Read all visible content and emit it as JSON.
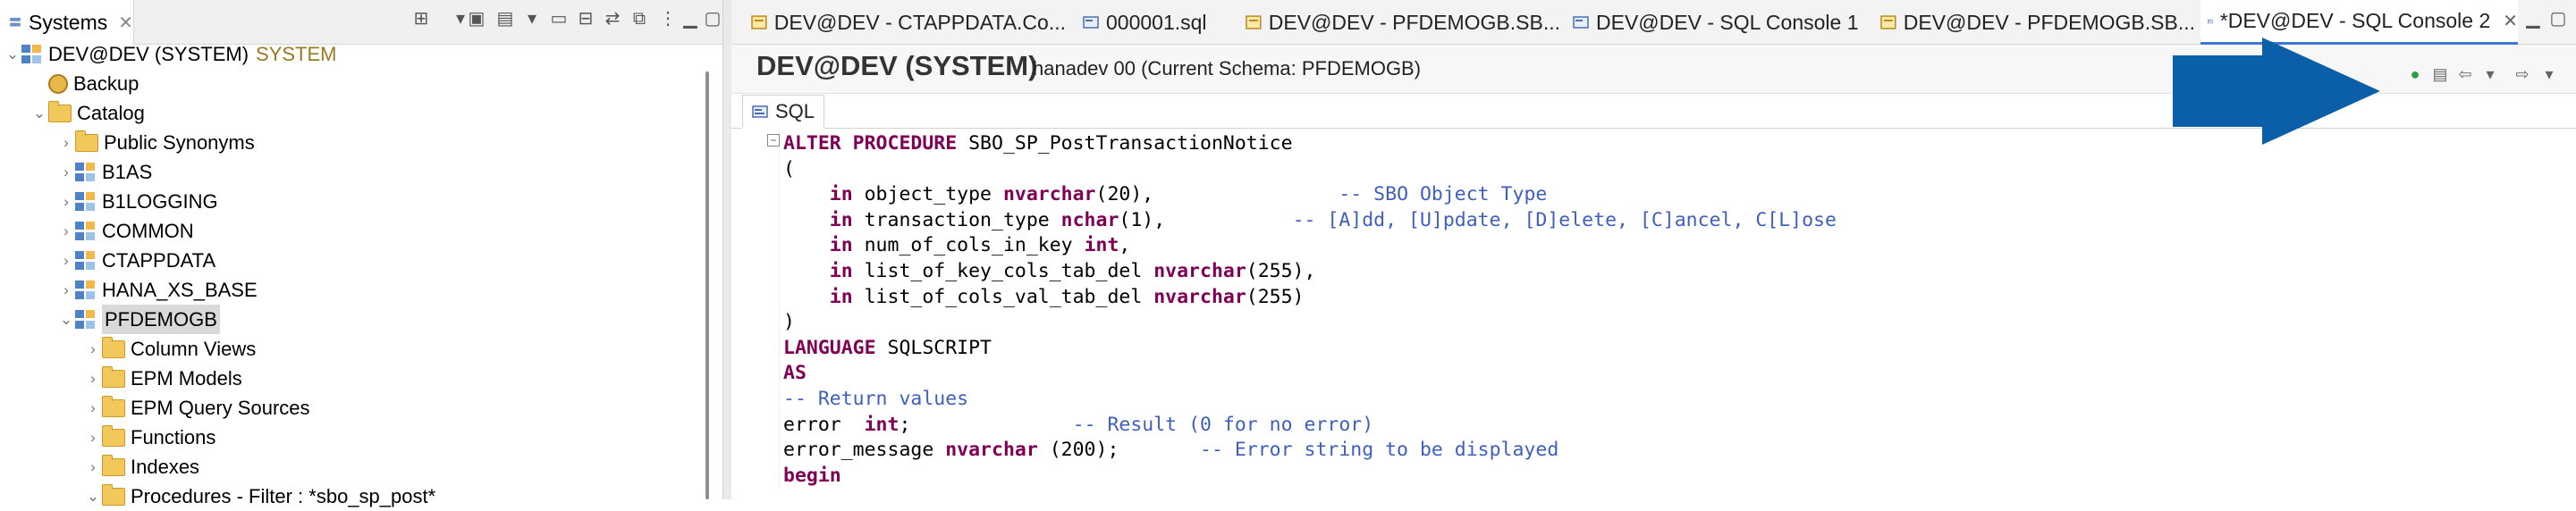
{
  "left_panel": {
    "tab_label": "Systems",
    "tree": [
      {
        "label": "DEV@DEV (SYSTEM)",
        "suffix": "SYSTEM",
        "level": 0,
        "expanded": true,
        "icon": "system-icon"
      },
      {
        "label": "Backup",
        "level": 1,
        "icon": "backup-icon"
      },
      {
        "label": "Catalog",
        "level": 1,
        "expanded": true,
        "icon": "folder-icon"
      },
      {
        "label": "Public Synonyms",
        "level": 2,
        "icon": "folder-icon"
      },
      {
        "label": "B1AS",
        "level": 2,
        "icon": "schema-icon"
      },
      {
        "label": "B1LOGGING",
        "level": 2,
        "icon": "schema-icon"
      },
      {
        "label": "COMMON",
        "level": 2,
        "icon": "schema-icon"
      },
      {
        "label": "CTAPPDATA",
        "level": 2,
        "icon": "schema-icon"
      },
      {
        "label": "HANA_XS_BASE",
        "level": 2,
        "icon": "schema-icon"
      },
      {
        "label": "PFDEMOGB",
        "level": 2,
        "expanded": true,
        "selected": true,
        "icon": "schema-icon"
      },
      {
        "label": "Column Views",
        "level": 3,
        "icon": "folder-icon"
      },
      {
        "label": "EPM Models",
        "level": 3,
        "icon": "folder-icon"
      },
      {
        "label": "EPM Query Sources",
        "level": 3,
        "icon": "folder-icon"
      },
      {
        "label": "Functions",
        "level": 3,
        "icon": "folder-icon"
      },
      {
        "label": "Indexes",
        "level": 3,
        "icon": "folder-icon"
      },
      {
        "label": "Procedures - Filter : *sbo_sp_post*",
        "level": 3,
        "expanded": true,
        "icon": "folder-icon"
      }
    ]
  },
  "editor": {
    "tabs": [
      {
        "label": "DEV@DEV - CTAPPDATA.Co...",
        "icon": "procedure-icon"
      },
      {
        "label": "000001.sql",
        "icon": "sql-icon"
      },
      {
        "label": "DEV@DEV - PFDEMOGB.SB...",
        "icon": "procedure-icon"
      },
      {
        "label": "DEV@DEV - SQL Console 1",
        "icon": "sql-icon"
      },
      {
        "label": "DEV@DEV - PFDEMOGB.SB...",
        "icon": "procedure-icon"
      },
      {
        "label": "*DEV@DEV - SQL Console 2",
        "icon": "sql-icon",
        "active": true
      }
    ],
    "connection_title": "DEV@DEV (SYSTEM)",
    "connection_subtitle": "hanadev 00 (Current Schema: PFDEMOGB)",
    "subtab_label": "SQL",
    "code_lines": [
      [
        [
          "kw",
          "ALTER PROCEDURE"
        ],
        [
          "t",
          " SBO_SP_PostTransactionNotice"
        ]
      ],
      [
        [
          "t",
          "("
        ]
      ],
      [
        [
          "t",
          "    "
        ],
        [
          "kw",
          "in"
        ],
        [
          "t",
          " object_type "
        ],
        [
          "kw",
          "nvarchar"
        ],
        [
          "t",
          "(20),                "
        ],
        [
          "cm",
          "-- SBO Object Type"
        ]
      ],
      [
        [
          "t",
          "    "
        ],
        [
          "kw",
          "in"
        ],
        [
          "t",
          " transaction_type "
        ],
        [
          "kw",
          "nchar"
        ],
        [
          "t",
          "(1),           "
        ],
        [
          "cm",
          "-- [A]dd, [U]pdate, [D]elete, [C]ancel, C[L]ose"
        ]
      ],
      [
        [
          "t",
          "    "
        ],
        [
          "kw",
          "in"
        ],
        [
          "t",
          " num_of_cols_in_key "
        ],
        [
          "kw",
          "int"
        ],
        [
          "t",
          ","
        ]
      ],
      [
        [
          "t",
          "    "
        ],
        [
          "kw",
          "in"
        ],
        [
          "t",
          " list_of_key_cols_tab_del "
        ],
        [
          "kw",
          "nvarchar"
        ],
        [
          "t",
          "(255),"
        ]
      ],
      [
        [
          "t",
          "    "
        ],
        [
          "kw",
          "in"
        ],
        [
          "t",
          " list_of_cols_val_tab_del "
        ],
        [
          "kw",
          "nvarchar"
        ],
        [
          "t",
          "(255)"
        ]
      ],
      [
        [
          "t",
          ")"
        ]
      ],
      [
        [
          "kw",
          "LANGUAGE"
        ],
        [
          "t",
          " SQLSCRIPT"
        ]
      ],
      [
        [
          "kw",
          "AS"
        ]
      ],
      [
        [
          "cm",
          "-- Return values"
        ]
      ],
      [
        [
          "t",
          "error  "
        ],
        [
          "kw",
          "int"
        ],
        [
          "t",
          ";              "
        ],
        [
          "cm",
          "-- Result (0 for no error)"
        ]
      ],
      [
        [
          "t",
          "error_message "
        ],
        [
          "kw",
          "nvarchar"
        ],
        [
          "t",
          " (200);       "
        ],
        [
          "cm",
          "-- Error string to be displayed"
        ]
      ],
      [
        [
          "kw",
          "begin"
        ]
      ]
    ]
  },
  "colors": {
    "keyword": "#7f0055",
    "comment": "#3f5fbf",
    "arrow": "#0b5ea8",
    "selection": "#d9d9d9"
  }
}
